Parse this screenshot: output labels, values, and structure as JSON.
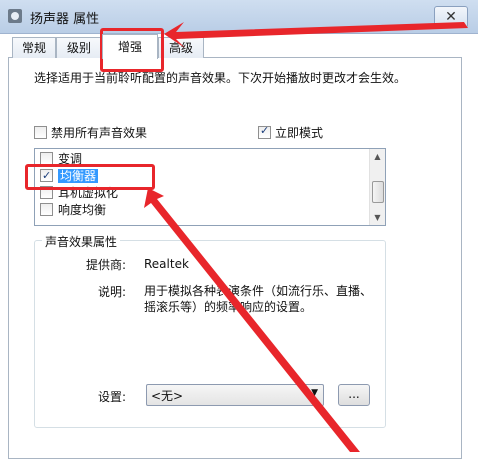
{
  "window": {
    "title": "扬声器 属性",
    "close_glyph": "✕"
  },
  "tabs": [
    {
      "label": "常规"
    },
    {
      "label": "级别"
    },
    {
      "label": "增强",
      "active": true
    },
    {
      "label": "高级"
    }
  ],
  "description": "选择适用于当前聆听配置的声音效果。下次开始播放时更改才会生效。",
  "disable_all": {
    "label": "禁用所有声音效果",
    "checked": false
  },
  "immediate_mode": {
    "label": "立即模式",
    "checked": true
  },
  "effects_list": [
    {
      "label": "变调",
      "checked": false
    },
    {
      "label": "均衡器",
      "checked": true,
      "selected": true
    },
    {
      "label": "耳机虚拟化",
      "checked": false
    },
    {
      "label": "响度均衡",
      "checked": false
    }
  ],
  "properties": {
    "group_title": "声音效果属性",
    "provider_label": "提供商:",
    "provider_value": "Realtek",
    "description_label": "说明:",
    "description_value": "用于模拟各种表演条件（如流行乐、直播、摇滚乐等）的频率响应的设置。",
    "settings_label": "设置:",
    "settings_value": "<无>",
    "more_button": "..."
  },
  "annotation_color": "#e8262b"
}
